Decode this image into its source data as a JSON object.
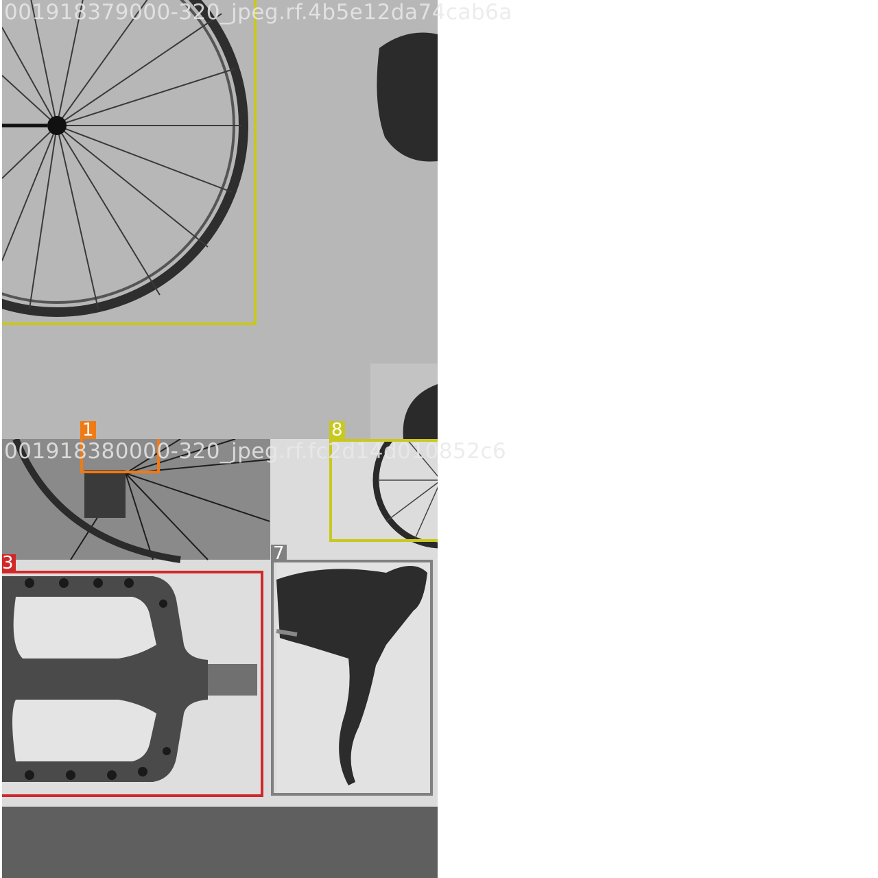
{
  "image_names": {
    "top": "001918379000-320_jpeg.rf.4b5e12da74cab6a",
    "bottom": "001918380000-320_jpeg.rf.fc2d14d010852c6"
  },
  "detections": [
    {
      "class_id": "8",
      "color": "#c8c81e"
    },
    {
      "class_id": "1",
      "color": "#f07a14"
    },
    {
      "class_id": "8",
      "color": "#c8c81e"
    },
    {
      "class_id": "3",
      "color": "#d02828"
    },
    {
      "class_id": "7",
      "color": "#808080"
    }
  ],
  "colors": {
    "tile_top_bg": "#b7b7b7",
    "tile_bottom_bg": "#dcdcdc",
    "padding_bg": "#5f5f5f"
  }
}
